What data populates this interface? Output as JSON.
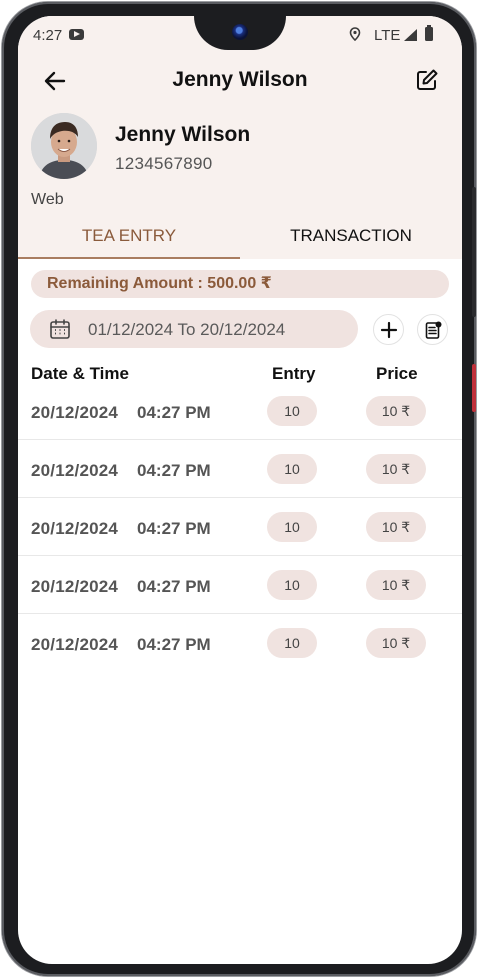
{
  "status_bar": {
    "time": "4:27",
    "network": "LTE"
  },
  "app_bar": {
    "title": "Jenny Wilson"
  },
  "profile": {
    "name": "Jenny Wilson",
    "phone": "1234567890",
    "source": "Web"
  },
  "tabs": [
    {
      "label": "TEA ENTRY",
      "active": true
    },
    {
      "label": "TRANSACTION",
      "active": false
    }
  ],
  "remaining": {
    "label": "Remaining Amount : 500.00 ₹"
  },
  "date_filter": {
    "range": "01/12/2024 To 20/12/2024"
  },
  "table": {
    "headers": {
      "datetime": "Date & Time",
      "entry": "Entry",
      "price": "Price"
    },
    "rows": [
      {
        "date": "20/12/2024",
        "time": "04:27 PM",
        "entry": "10",
        "price": "10 ₹"
      },
      {
        "date": "20/12/2024",
        "time": "04:27 PM",
        "entry": "10",
        "price": "10 ₹"
      },
      {
        "date": "20/12/2024",
        "time": "04:27 PM",
        "entry": "10",
        "price": "10 ₹"
      },
      {
        "date": "20/12/2024",
        "time": "04:27 PM",
        "entry": "10",
        "price": "10 ₹"
      },
      {
        "date": "20/12/2024",
        "time": "04:27 PM",
        "entry": "10",
        "price": "10 ₹"
      }
    ]
  },
  "colors": {
    "header_bg": "#f8f1ee",
    "accent": "#8a5a3b",
    "pill_bg": "#f0e3e0",
    "side_button": "#c0303a"
  }
}
